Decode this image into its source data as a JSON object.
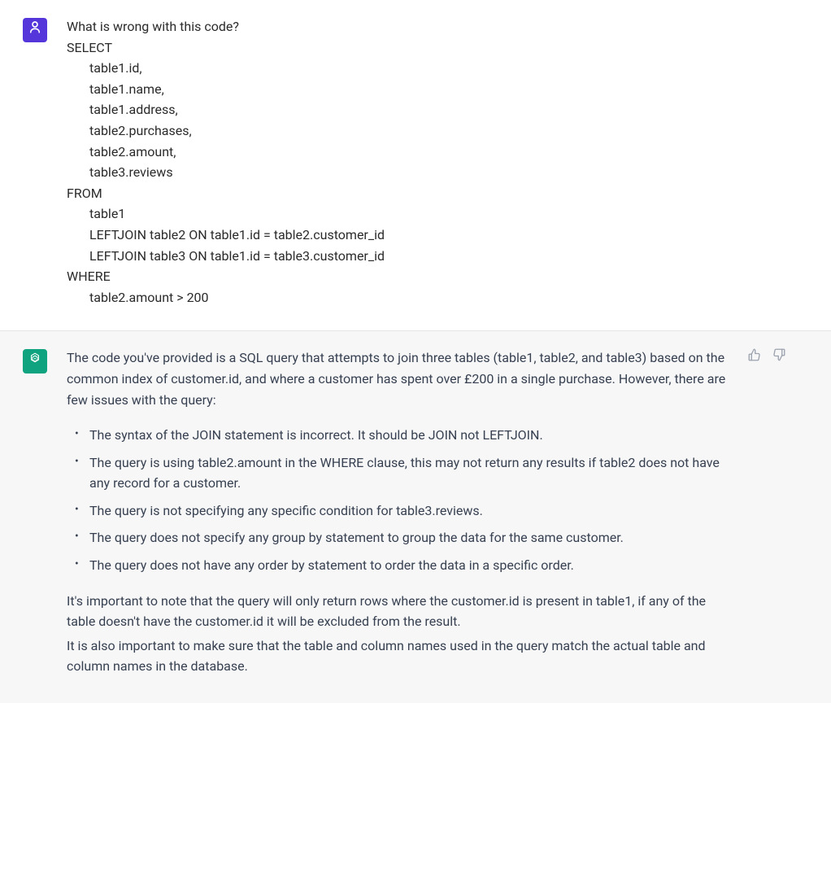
{
  "user": {
    "lines": [
      {
        "text": "What is wrong with this code?",
        "indent": false
      },
      {
        "text": "SELECT",
        "indent": false
      },
      {
        "text": "table1.id,",
        "indent": true
      },
      {
        "text": "table1.name,",
        "indent": true
      },
      {
        "text": "table1.address,",
        "indent": true
      },
      {
        "text": "table2.purchases,",
        "indent": true
      },
      {
        "text": "table2.amount,",
        "indent": true
      },
      {
        "text": "table3.reviews",
        "indent": true
      },
      {
        "text": "FROM",
        "indent": false
      },
      {
        "text": "table1",
        "indent": true
      },
      {
        "text": "LEFTJOIN table2 ON table1.id = table2.customer_id",
        "indent": true
      },
      {
        "text": "LEFTJOIN table3 ON table1.id = table3.customer_id",
        "indent": true
      },
      {
        "text": "WHERE",
        "indent": false
      },
      {
        "text": "table2.amount > 200",
        "indent": true
      }
    ]
  },
  "assistant": {
    "intro": "The code you've provided is a SQL query that attempts to join three tables (table1, table2, and table3) based on the common index of customer.id, and where a customer has spent over £200 in a single purchase. However, there are few issues with the query:",
    "bullets": [
      "The syntax of the JOIN statement is incorrect. It should be JOIN not LEFTJOIN.",
      "The query is using table2.amount in the WHERE clause, this may not return any results if table2 does not have any record for a customer.",
      "The query is not specifying any specific condition for table3.reviews.",
      "The query does not specify any group by statement to group the data for the same customer.",
      "The query does not have any order by statement to order the data in a specific order."
    ],
    "outro1": "It's important to note that the query will only return rows where the customer.id is present in table1, if any of the table doesn't have the customer.id it will be excluded from the result.",
    "outro2": "It is also important to make sure that the table and column names used in the query match the actual table and column names in the database."
  },
  "icons": {
    "user": "user-icon",
    "assistant": "openai-icon",
    "thumbs_up": "thumbs-up-icon",
    "thumbs_down": "thumbs-down-icon"
  }
}
